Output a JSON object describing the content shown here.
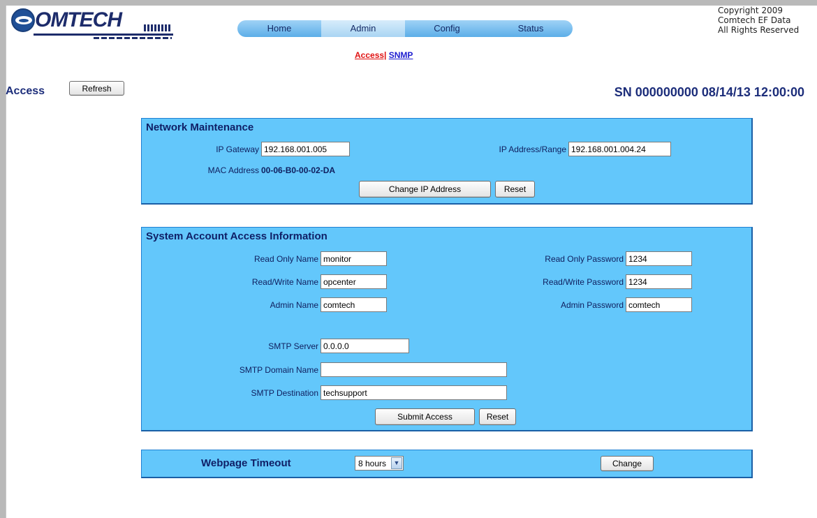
{
  "logo": {
    "text": "OMTECH"
  },
  "nav": {
    "tabs": [
      {
        "label": "Home"
      },
      {
        "label": "Admin"
      },
      {
        "label": "Config"
      },
      {
        "label": "Status"
      }
    ],
    "active_tab": "Admin",
    "subnav": {
      "access": "Access|",
      "snmp": "SNMP"
    }
  },
  "copyright": {
    "line1": "Copyright 2009",
    "line2": "Comtech EF Data",
    "line3": "All Rights Reserved"
  },
  "header": {
    "title": "Access",
    "refresh_label": "Refresh",
    "serial_line": "SN 000000000 08/14/13 12:00:00"
  },
  "network": {
    "title": "Network Maintenance",
    "ip_gateway_label": "IP Gateway",
    "ip_gateway_value": "192.168.001.005",
    "ip_range_label": "IP Address/Range",
    "ip_range_value": "192.168.001.004.24",
    "mac_label": "MAC Address",
    "mac_value": "00-06-B0-00-02-DA",
    "change_ip_label": "Change IP Address",
    "reset_label": "Reset"
  },
  "accounts": {
    "title": "System Account Access Information",
    "ro_name_label": "Read Only Name",
    "ro_name_value": "monitor",
    "ro_pass_label": "Read Only Password",
    "ro_pass_value": "1234",
    "rw_name_label": "Read/Write Name",
    "rw_name_value": "opcenter",
    "rw_pass_label": "Read/Write Password",
    "rw_pass_value": "1234",
    "admin_name_label": "Admin Name",
    "admin_name_value": "comtech",
    "admin_pass_label": "Admin Password",
    "admin_pass_value": "comtech",
    "smtp_server_label": "SMTP Server",
    "smtp_server_value": "0.0.0.0",
    "smtp_domain_label": "SMTP Domain Name",
    "smtp_domain_value": "",
    "smtp_dest_label": "SMTP Destination",
    "smtp_dest_value": "techsupport",
    "submit_label": "Submit Access",
    "reset_label": "Reset"
  },
  "timeout": {
    "title": "Webpage Timeout",
    "selected": "8 hours",
    "change_label": "Change"
  }
}
